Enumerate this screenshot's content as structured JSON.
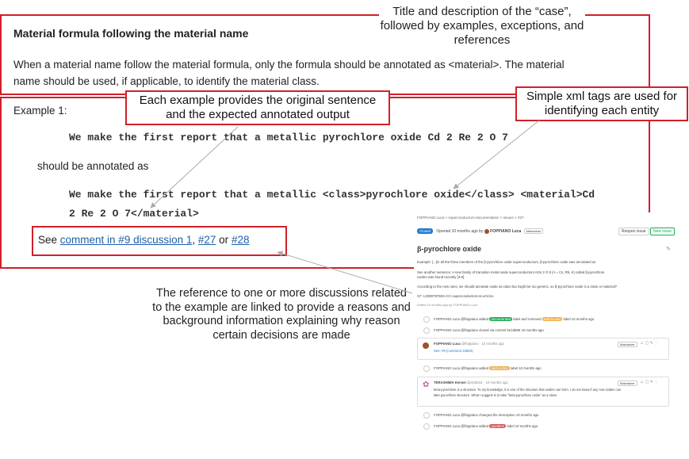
{
  "doc": {
    "section_title": "Material formula following the material name",
    "desc_line1": "When a material name follow the material formula, only the formula should be annotated as <material>. The material",
    "desc_line2": "name should be used, if applicable, to identify the material class.",
    "example_label": "Example 1:",
    "original_sentence": "We make the first report that a metallic pyrochlore oxide Cd 2 Re 2 O 7",
    "should_be": "should be annotated as",
    "annotated_line1": "We make the first report that a metallic <class>pyrochlore oxide</class> <material>Cd",
    "annotated_line2": "2 Re 2 O 7</material>",
    "see_prefix": "See ",
    "see_link1": "comment in #9 discussion 1",
    "see_comma": ", ",
    "see_link2": "#27",
    "see_or": " or ",
    "see_link3": "#28"
  },
  "callouts": {
    "title": "Title and description of the “case”, followed by examples, exceptions, and references",
    "example": "Each example provides the original sentence and the expected annotated output",
    "xml": "Simple xml tags are used for identifying each entity",
    "reference": "The reference to one or more discussions related to the example are linked to provide a reasons and background information explaining why reason certain decisions are made"
  },
  "screenshot": {
    "breadcrumb": "FOPPIANO Luca  >  superconductors-documentation  >  Issues  >  #27",
    "status": "Closed",
    "opened": "Opened 10 months ago by",
    "author": "FOPPIANO Luca",
    "author_role": "Maintainer",
    "reopen": "Reopen issue",
    "new_issue": "New issue",
    "title": "β-pyrochlore oxide",
    "example_text": "Example: [...]in all the three members of the β-pyrochlore oxide superconductors, β-pyrochlore oxide was annotated as",
    "another_text": "See another sentence: A new family of transition metal oxide superconductors AOs 2 O 6 (A = Cs, Rb, K) called β-pyrochlore",
    "another_text2": "oxides was found recently [3-6].",
    "rules_text": "According to the new rules, we should annotate oxide as class but might be too generic, so β-pyrochlore oxide is a class or material?",
    "cf_text": "CF: L03807876DA-CC.superconductors.tei.xml.tsv",
    "edited": "Edited 10 months ago by FOPPIANO Luca",
    "events": [
      {
        "text": "FOPPIANO Luca @lfoppiano added",
        "label": "documented",
        "label_color": "#1aaa55",
        "text2": "label and removed",
        "label2": "add-to-doc",
        "label2_color": "#f0ad4e",
        "text3": "label 10 months ago"
      },
      {
        "text": "FOPPIANO Luca @lfoppiano closed via commit be1d586 10 months ago"
      }
    ],
    "comment1": {
      "author": "FOPPIANO Luca",
      "meta": "@lfoppiano · 10 months ago",
      "role": "Maintainer",
      "body": "See: #9 (comment 34804)"
    },
    "event3": {
      "text": "FOPPIANO Luca @lfoppiano added",
      "label": "add-to-doc",
      "label_color": "#f0ad4e",
      "text2": "label 10 months ago"
    },
    "comment2": {
      "author": "TERASHIMA Kensei",
      "meta": "@ai18044 · 10 months ago",
      "role": "Maintainer",
      "body1": "beta-pyrochlore is a structure. To my knowledge, it is one of the structure that oxides can form. I do not know if any non-oxides can",
      "body2": "take pyrochlore structure. What I suggest is to take \"beta-pyrochlore oxide\" as a class."
    },
    "event5": {
      "text": "FOPPIANO Luca @lfoppiano changed the description 10 months ago"
    },
    "event6": {
      "text": "FOPPIANO Luca @lfoppiano added",
      "label": "question",
      "label_color": "#d9534f",
      "text2": "label 10 months ago"
    }
  }
}
